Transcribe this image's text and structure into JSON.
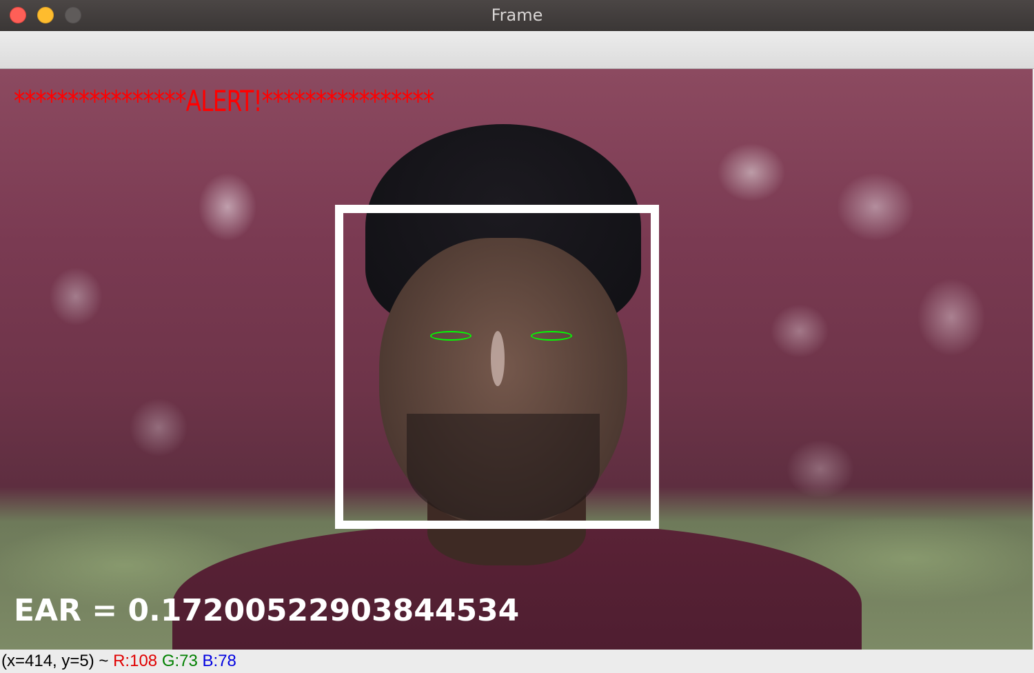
{
  "window": {
    "title": "Frame"
  },
  "overlay": {
    "alert_text": "****************ALERT!****************",
    "ear_text": "EAR = 0.17200522903844534",
    "alert_color": "#ff0000",
    "ear_color": "#ffffff",
    "facebox_color": "#ffffff",
    "eye_contour_color": "#00ff00"
  },
  "status": {
    "coords": "(x=414, y=5) ~ ",
    "r": "R:108",
    "g": "G:73",
    "b": "B:78"
  }
}
